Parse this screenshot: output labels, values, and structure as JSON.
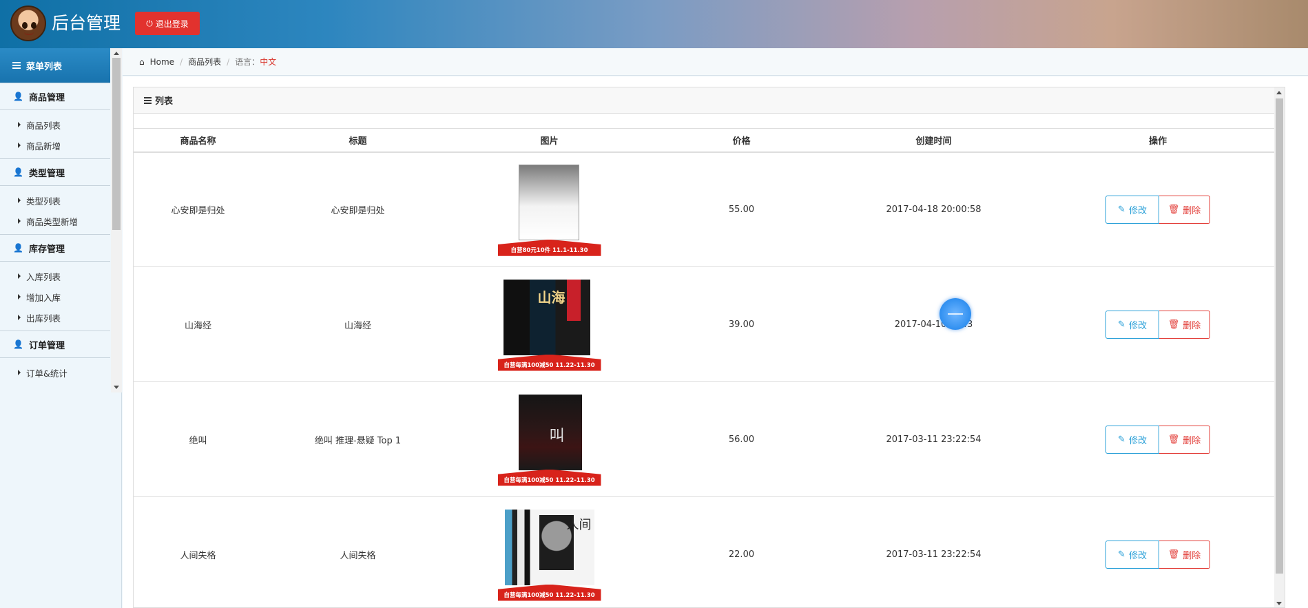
{
  "header": {
    "title": "后台管理",
    "logout_label": "退出登录",
    "accent_color": "#e2322e"
  },
  "sidebar": {
    "menu_title": "菜单列表",
    "groups": [
      {
        "title": "商品管理",
        "items": [
          "商品列表",
          "商品新增"
        ]
      },
      {
        "title": "类型管理",
        "items": [
          "类型列表",
          "商品类型新增"
        ]
      },
      {
        "title": "库存管理",
        "items": [
          "入库列表",
          "增加入库",
          "出库列表"
        ]
      },
      {
        "title": "订单管理",
        "items": [
          "订单&统计"
        ]
      }
    ]
  },
  "breadcrumb": {
    "home": "Home",
    "current": "商品列表",
    "lang_label": "语言：",
    "lang_value": "中文"
  },
  "panel": {
    "title": "列表",
    "columns": [
      "商品名称",
      "标题",
      "图片",
      "价格",
      "创建时间",
      "操作"
    ],
    "edit_label": "修改",
    "delete_label": "删除",
    "rows": [
      {
        "name": "心安即是归处",
        "title": "心安即是归处",
        "price": "55.00",
        "created": "2017-04-18 20:00:58",
        "promo": "自营80元10件 11.1-11.30"
      },
      {
        "name": "山海经",
        "title": "山海经",
        "price": "39.00",
        "created": "2017-04-10 …:43",
        "promo": "自营每满100减50 11.22-11.30"
      },
      {
        "name": "绝叫",
        "title": "绝叫 推理-悬疑 Top 1",
        "price": "56.00",
        "created": "2017-03-11 23:22:54",
        "promo": "自营每满100减50 11.22-11.30"
      },
      {
        "name": "人间失格",
        "title": "人间失格",
        "price": "22.00",
        "created": "2017-03-11 23:22:54",
        "promo": "自营每满100减50 11.22-11.30"
      }
    ]
  }
}
